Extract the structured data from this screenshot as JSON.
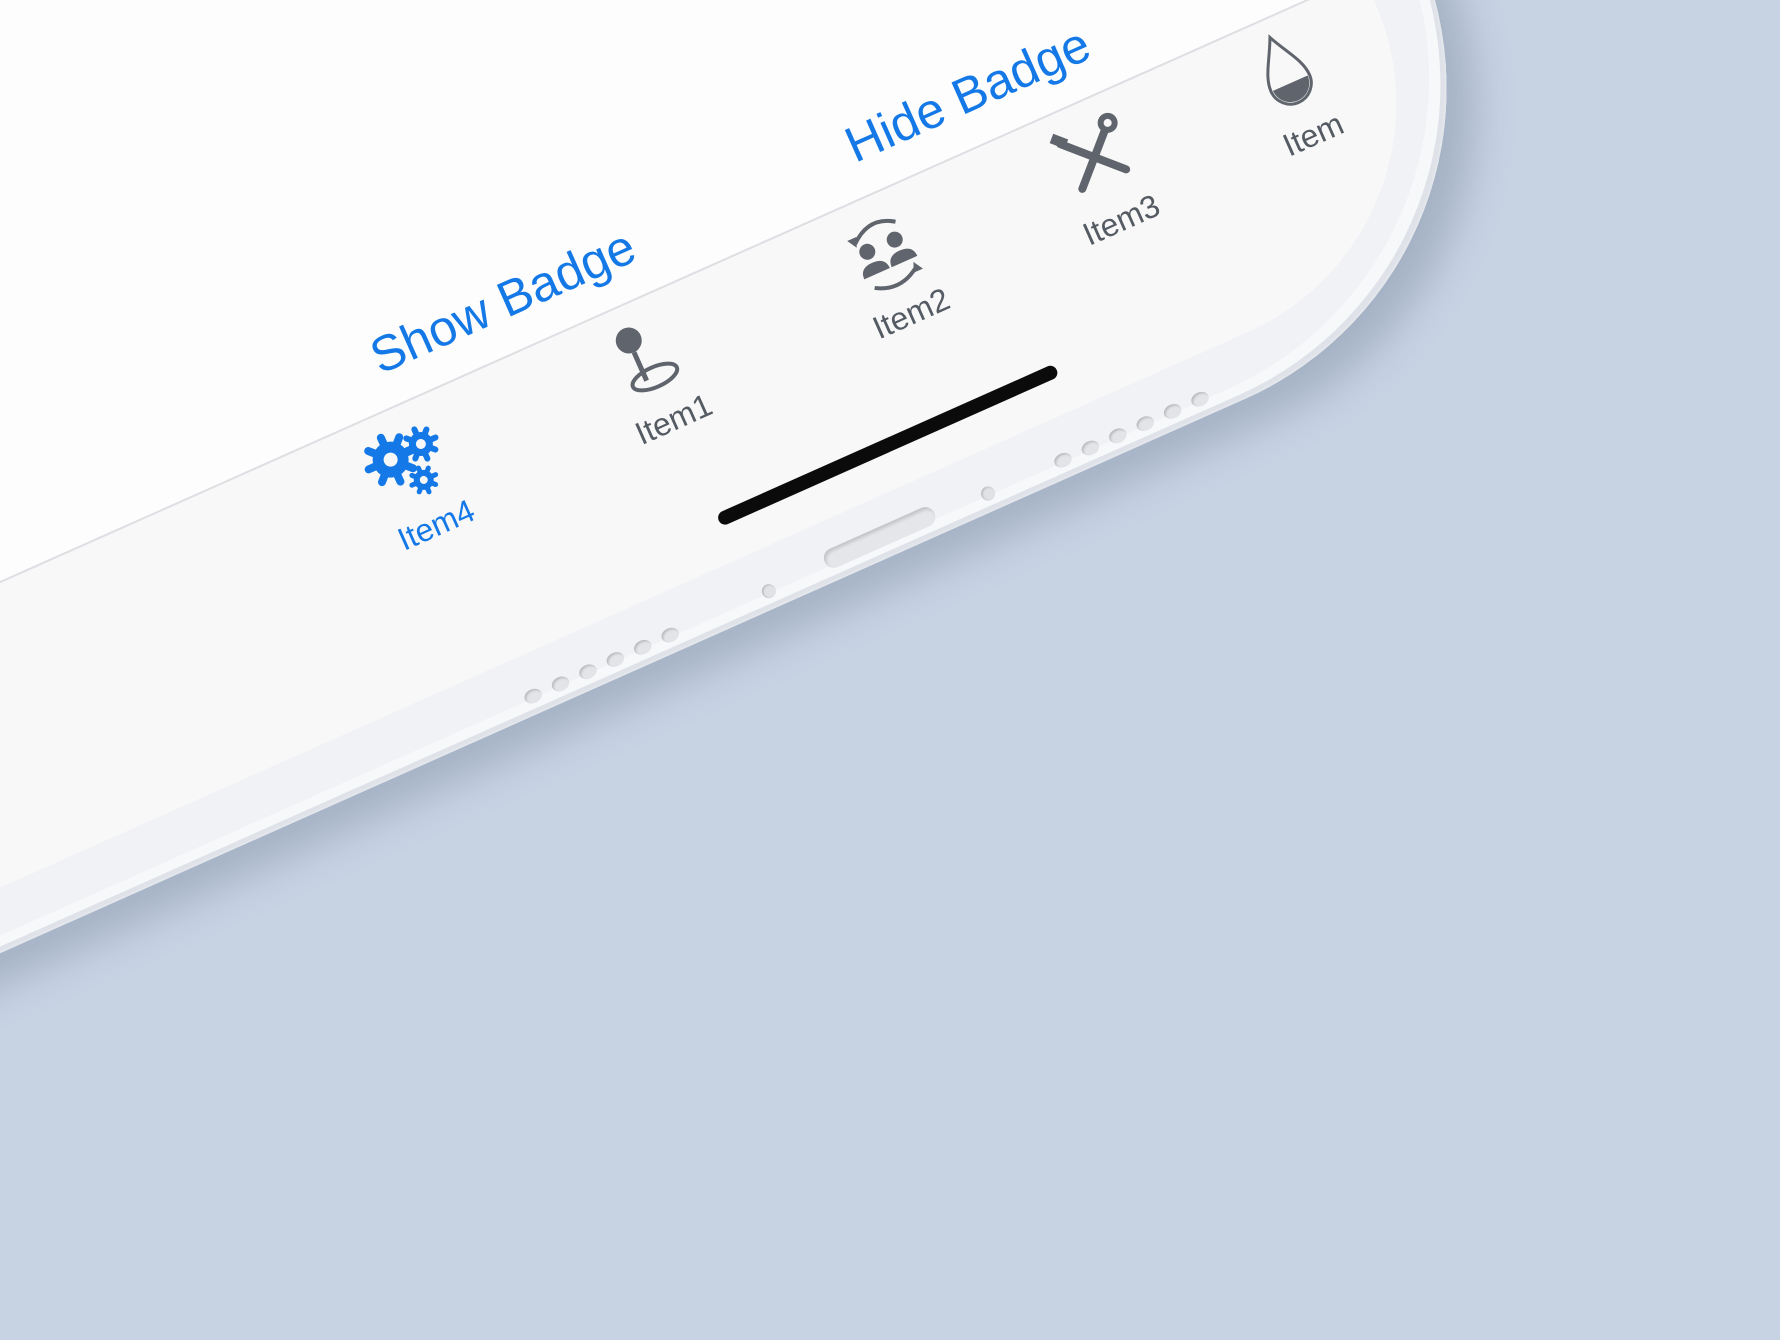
{
  "screen": {
    "buttons": {
      "show_badge": "Show Badge",
      "hide_badge": "Hide Badge"
    }
  },
  "tabbar": {
    "active_color": "#1479e6",
    "inactive_color": "#555b63",
    "items": [
      {
        "label": "Item4",
        "icon": "gears-icon",
        "active": true
      },
      {
        "label": "Item1",
        "icon": "map-pin-icon",
        "active": false
      },
      {
        "label": "Item2",
        "icon": "user-switch-icon",
        "active": false
      },
      {
        "label": "Item3",
        "icon": "tools-icon",
        "active": false
      },
      {
        "label": "Item",
        "icon": "drop-icon",
        "active": false
      }
    ]
  }
}
